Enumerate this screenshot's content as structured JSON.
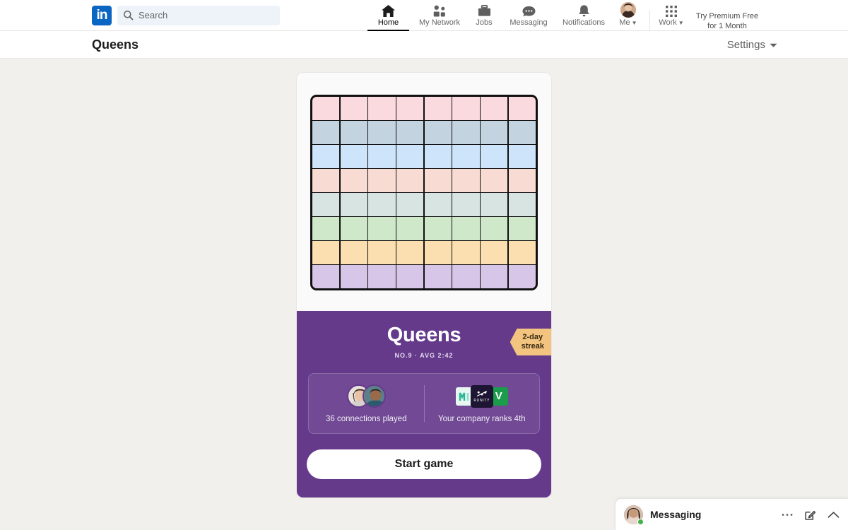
{
  "nav": {
    "logo_text": "in",
    "search": {
      "placeholder": "Search",
      "value": ""
    },
    "items": [
      {
        "label": "Home",
        "icon": "home-icon",
        "active": true
      },
      {
        "label": "My Network",
        "icon": "network-icon",
        "active": false
      },
      {
        "label": "Jobs",
        "icon": "jobs-icon",
        "active": false
      },
      {
        "label": "Messaging",
        "icon": "messaging-icon",
        "active": false
      },
      {
        "label": "Notifications",
        "icon": "bell-icon",
        "active": false
      },
      {
        "label": "Me",
        "icon": "avatar-icon",
        "active": false
      },
      {
        "label": "Work",
        "icon": "grid-apps-icon",
        "active": false
      }
    ],
    "premium_line1": "Try Premium Free",
    "premium_line2": "for 1 Month"
  },
  "subheader": {
    "title": "Queens",
    "settings_label": "Settings"
  },
  "game": {
    "title": "Queens",
    "meta": "NO.9  ·  AVG 2:42",
    "streak_line1": "2-day",
    "streak_line2": "streak",
    "connections_label": "36 connections played",
    "company_label": "Your company ranks 4th",
    "start_button": "Start game",
    "logos": [
      {
        "name": "logo-m",
        "text": "M"
      },
      {
        "name": "logo-runity",
        "text": "RUNITY"
      },
      {
        "name": "logo-v",
        "text": "V"
      }
    ],
    "board": {
      "rows": 8,
      "cols": 8,
      "row_colors": [
        "#fbdadf",
        "#c3d3e0",
        "#cee4fb",
        "#f8dbd3",
        "#d7e4e2",
        "#d0e8ca",
        "#fbdfb0",
        "#d7c6e8"
      ]
    }
  },
  "messaging": {
    "title": "Messaging",
    "more_icon": "ellipsis-icon",
    "compose_icon": "compose-icon",
    "expand_icon": "chevron-up-icon"
  },
  "colors": {
    "brand": "#0a66c2",
    "purple": "#653a8b",
    "ribbon": "#f2c480",
    "page_bg": "#f1f0ec"
  }
}
